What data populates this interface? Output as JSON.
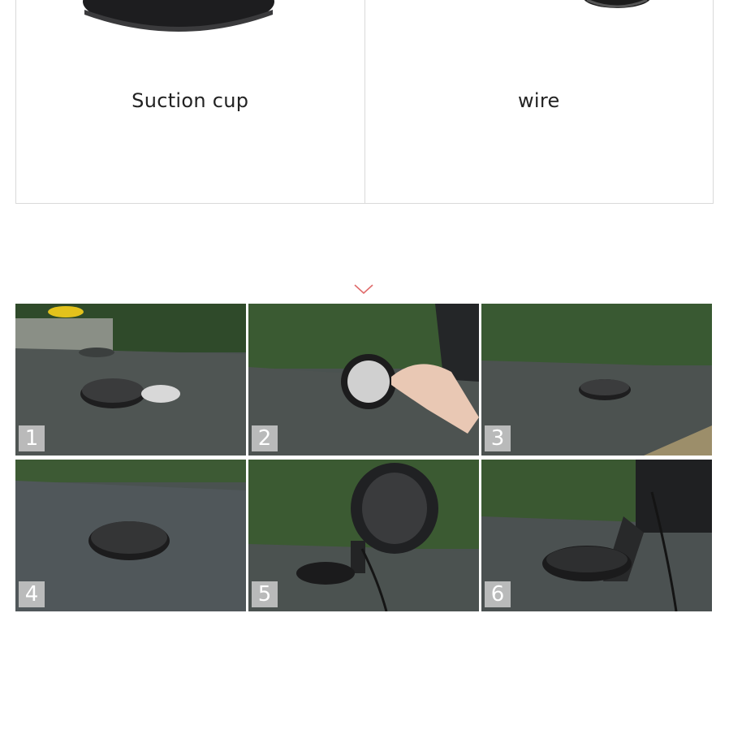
{
  "parts": [
    {
      "label": "Suction cup",
      "icon": "suction-cup-image"
    },
    {
      "label": "wire",
      "icon": "wire-image"
    }
  ],
  "accent_color": "#e06b6b",
  "steps": [
    {
      "number": "1",
      "description_icon": "suction-pad-and-sticker-on-dashboard"
    },
    {
      "number": "2",
      "description_icon": "hand-peeling-adhesive-disc"
    },
    {
      "number": "3",
      "description_icon": "disc-placed-on-dashboard"
    },
    {
      "number": "4",
      "description_icon": "disc-close-up"
    },
    {
      "number": "5",
      "description_icon": "fan-mounted-on-disc"
    },
    {
      "number": "6",
      "description_icon": "fan-mount-close-up"
    }
  ]
}
